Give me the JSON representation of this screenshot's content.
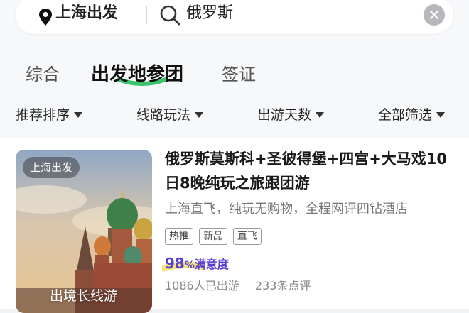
{
  "search": {
    "location": "上海出发",
    "query": "俄罗斯"
  },
  "tabs": [
    {
      "label": "综合",
      "active": false
    },
    {
      "label": "出发地参团",
      "active": true
    },
    {
      "label": "签证",
      "active": false
    }
  ],
  "filters": [
    {
      "label": "推荐排序"
    },
    {
      "label": "线路玩法"
    },
    {
      "label": "出游天数"
    },
    {
      "label": "全部筛选"
    }
  ],
  "product": {
    "badge": "上海出发",
    "caption": "出境长线游",
    "title": "俄罗斯莫斯科+圣彼得堡+四宫+大马戏10日8晚纯玩之旅跟团游",
    "description": "上海直飞，纯玩无购物，全程网评四钻酒店",
    "tags": [
      "热推",
      "新品",
      "直飞"
    ],
    "satisfaction_value": "98",
    "satisfaction_unit": "%",
    "satisfaction_label": "满意度",
    "travelers": "1086人已出游",
    "reviews": "233条点评"
  },
  "colors": {
    "accent_green": "#3cc36e",
    "rating_purple": "#5a3fd0",
    "rating_highlight": "#f6e27a"
  },
  "icons": {
    "location": "location-pin-icon",
    "search": "search-icon",
    "clear": "clear-icon",
    "caret": "caret-down-icon"
  }
}
